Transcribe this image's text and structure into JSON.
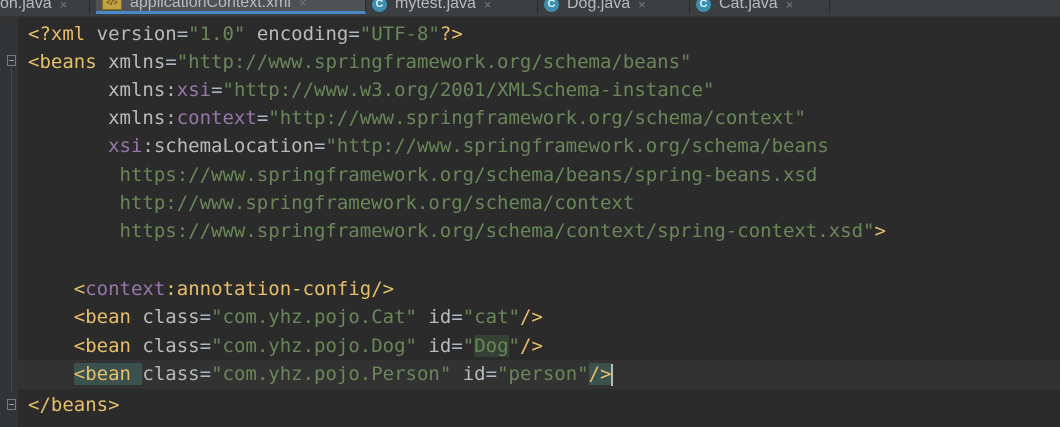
{
  "tabs": [
    {
      "label": "on.java",
      "icon": "none",
      "active": false
    },
    {
      "label": "applicationContext.xml",
      "icon": "xml-file-icon",
      "active": true
    },
    {
      "label": "mytest.java",
      "icon": "class-icon",
      "active": false
    },
    {
      "label": "Dog.java",
      "icon": "class-icon",
      "active": false
    },
    {
      "label": "Cat.java",
      "icon": "class-icon",
      "active": false
    }
  ],
  "tab_close_glyph": "×",
  "class_icon_letter": "C",
  "xml_icon_text": "</>",
  "code": {
    "l1": {
      "a": "<?xml ",
      "b": "version",
      "c": "=",
      "d": "\"1.0\"",
      "e": " ",
      "f": "encoding",
      "g": "=",
      "h": "\"UTF-8\"",
      "i": "?>"
    },
    "l2": {
      "a": "<beans ",
      "b": "xmlns",
      "c": "=",
      "d": "\"http://www.springframework.org/schema/beans\""
    },
    "l3": {
      "pad": "       ",
      "b": "xmlns",
      "c": ":",
      "d": "xsi",
      "e": "=",
      "f": "\"http://www.w3.org/2001/XMLSchema-instance\""
    },
    "l4": {
      "pad": "       ",
      "b": "xmlns",
      "c": ":",
      "d": "context",
      "e": "=",
      "f": "\"http://www.springframework.org/schema/context\""
    },
    "l5": {
      "pad": "       ",
      "b": "xsi",
      "c": ":",
      "d": "schemaLocation",
      "e": "=",
      "f": "\"http://www.springframework.org/schema/beans"
    },
    "l6": {
      "pad": "        ",
      "f": "https://www.springframework.org/schema/beans/spring-beans.xsd"
    },
    "l7": {
      "pad": "        ",
      "f": "http://www.springframework.org/schema/context"
    },
    "l8": {
      "pad": "        ",
      "f": "https://www.springframework.org/schema/context/spring-context.xsd\"",
      "g": ">"
    },
    "l9": {
      "text": ""
    },
    "l10": {
      "pad": "    ",
      "a": "<",
      "b": "context",
      "c": ":",
      "d": "annotation-config",
      "e": "/>"
    },
    "l11": {
      "pad": "    ",
      "a": "<bean ",
      "b": "class",
      "c": "=",
      "d": "\"com.yhz.pojo.Cat\"",
      "e": " ",
      "f": "id",
      "g": "=",
      "h": "\"cat\"",
      "i": "/>"
    },
    "l12": {
      "pad": "    ",
      "a": "<bean ",
      "b": "class",
      "c": "=",
      "d": "\"com.yhz.pojo.Dog\"",
      "e": " ",
      "f": "id",
      "g": "=",
      "h1": "\"",
      "h2": "Dog",
      "h3": "\"",
      "i": "/>"
    },
    "l13": {
      "pad": "    ",
      "a": "<bean ",
      "b": "class",
      "c": "=",
      "d": "\"com.yhz.pojo.Person\"",
      "e": " ",
      "f": "id",
      "g": "=",
      "h": "\"person\"",
      "i": "/>"
    },
    "l14": {
      "a": "</beans>"
    }
  },
  "colors": {
    "background": "#2b2b2b",
    "tag": "#e8bf6a",
    "namespace": "#9876aa",
    "string": "#6a8759",
    "attribute": "#bababa",
    "active_tab_underline": "#4a88c7"
  }
}
